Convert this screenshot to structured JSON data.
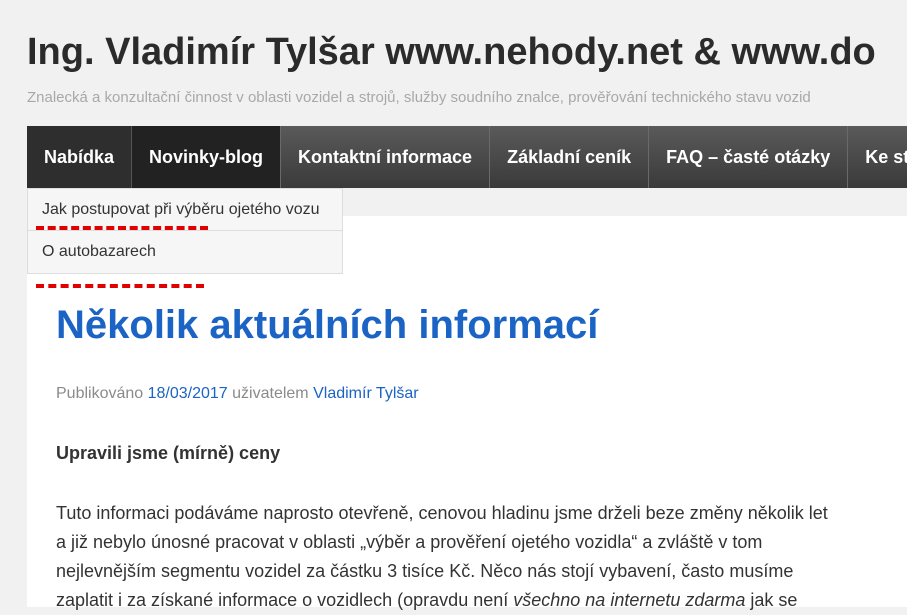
{
  "site": {
    "title": "Ing. Vladimír Tylšar www.nehody.net & www.do",
    "description": "Znalecká a konzultační činnost v oblasti vozidel a strojů, služby soudního znalce, prověřování technického stavu vozid"
  },
  "nav": {
    "items": [
      {
        "label": "Nabídka"
      },
      {
        "label": "Novinky-blog"
      },
      {
        "label": "Kontaktní informace"
      },
      {
        "label": "Základní ceník"
      },
      {
        "label": "FAQ – časté otázky"
      },
      {
        "label": "Ke staz"
      }
    ]
  },
  "submenu": {
    "items": [
      {
        "label": "Jak postupovat při výběru ojetého vozu"
      },
      {
        "label": "O autobazarech"
      }
    ]
  },
  "annotation_color": "#e10000",
  "post": {
    "title": "Několik aktuálních informací",
    "meta_prefix": "Publikováno",
    "date": "18/03/2017",
    "meta_by": "uživatelem",
    "author": "Vladimír Tylšar",
    "subheading": "Upravili jsme (mírně)  ceny",
    "lines": [
      "Tuto informaci podáváme naprosto otevřeně, cenovou hladinu jsme drželi beze změny několik let",
      "a již nebylo únosné pracovat  v oblasti  „výběr a prověření ojetého vozidla“  a zvláště  v tom",
      "nejlevnějším segmentu vozidel za částku 3 tisíce Kč. Něco nás stojí vybavení, často musíme"
    ],
    "last_line_start": "zaplatit i za získané informace o vozidlech  (opravdu není ",
    "last_line_em": "všechno na internetu zdarma",
    "last_line_end": " jak se"
  }
}
